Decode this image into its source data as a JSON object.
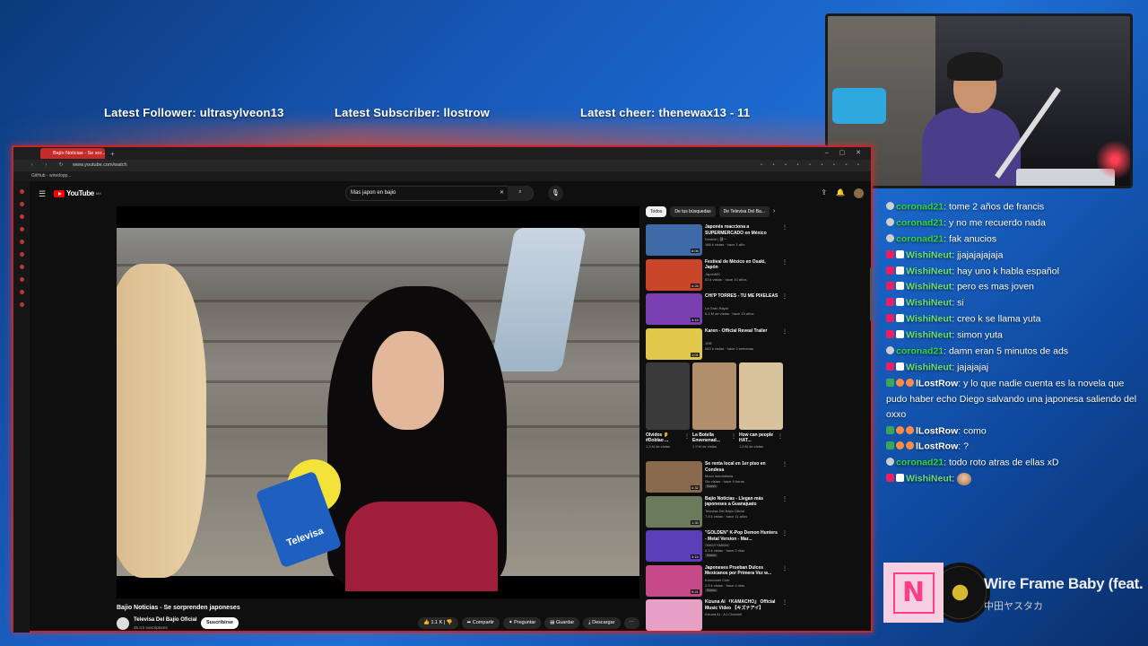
{
  "overlay": {
    "latest_follower": "Latest Follower: ultrasylveon13",
    "latest_subscriber": "Latest Subscriber: llostrow",
    "latest_cheer": "Latest cheer: thenewax13 - 11"
  },
  "chat": [
    {
      "user": "coronad21",
      "text": "tome 2 años de francis",
      "color": "#38d23b"
    },
    {
      "user": "coronad21",
      "text": "y no me recuerdo nada",
      "color": "#38d23b"
    },
    {
      "user": "coronad21",
      "text": "fak anucios",
      "color": "#38d23b"
    },
    {
      "user": "WishiNeut",
      "text": "jjajajajajaja",
      "color": "#6ee06e"
    },
    {
      "user": "WishiNeut",
      "text": "hay uno k habla español",
      "color": "#6ee06e"
    },
    {
      "user": "WishiNeut",
      "text": "pero es mas joven",
      "color": "#6ee06e"
    },
    {
      "user": "WishiNeut",
      "text": "si",
      "color": "#6ee06e"
    },
    {
      "user": "WishiNeut",
      "text": "creo k se llama yuta",
      "color": "#6ee06e"
    },
    {
      "user": "WishiNeut",
      "text": "simon yuta",
      "color": "#6ee06e"
    },
    {
      "user": "coronad21",
      "text": "damn eran 5 minutos de ads",
      "color": "#38d23b"
    },
    {
      "user": "WishiNeut",
      "text": "jajajajaj",
      "color": "#6ee06e"
    },
    {
      "user": "lLostRow",
      "text": "y lo que nadie cuenta es la novela que pudo haber echo Diego salvando una japonesa saliendo del oxxo",
      "color": "#ffffff"
    },
    {
      "user": "lLostRow",
      "text": "como",
      "color": "#ffffff"
    },
    {
      "user": "lLostRow",
      "text": "?",
      "color": "#ffffff"
    },
    {
      "user": "coronad21",
      "text": "todo roto atras de ellas xD",
      "color": "#38d23b"
    },
    {
      "user": "WishiNeut",
      "text": "",
      "color": "#6ee06e"
    }
  ],
  "now_playing": {
    "title": "Wire Frame Baby (feat.",
    "artist": "中田ヤスタカ",
    "logo": "N"
  },
  "browser": {
    "tab_title": "Bajío Noticias - Se sor...",
    "url": "www.youtube.com/watch",
    "bookmark": "GitHub - wiredopp..."
  },
  "youtube": {
    "logo_text": "YouTube",
    "logo_cc": "MX",
    "search_query": "Mas japon en bajio",
    "video_title": "Bajio Noticias - Se sorprenden japoneses",
    "channel": "Televisa Del Bajío Oficial",
    "subscribers": "45.3 k suscriptores",
    "subscribe": "Suscribirse",
    "likes": "1.1 K",
    "share": "Compartir",
    "ask": "Preguntar",
    "save": "Guardar",
    "download": "Descargar",
    "chips": [
      "Todos",
      "De tus búsquedas",
      "De Televisa Del Ba..."
    ],
    "recommendations": [
      {
        "title": "Japonés reacciona a SUPERMERCADO en México",
        "channel": "Kenichi | 健一",
        "views": "186 k vistas · hace 1 año",
        "duration": "8:06",
        "color": "#3f6aa8"
      },
      {
        "title": "Festival de México en Osaki, Japón",
        "channel": "JapónMX",
        "views": "53 k vistas · hace 10 años",
        "duration": "4:28",
        "color": "#c9462a"
      },
      {
        "title": "CHI'P TORRES - TÚ ME PIXELEAS",
        "channel": "La Gran Rayal",
        "views": "6.4 M de vistas · hace 13 años",
        "duration": "3:43",
        "color": "#7a3fb0"
      },
      {
        "title": "Karen - Official Reveal Trailer",
        "channel": "JDB",
        "views": "583 k vistas · hace 2 semanas",
        "duration": "1:01",
        "color": "#e0c84a"
      }
    ],
    "shorts": [
      {
        "title": "Olvidos 👂 #Doblao ...",
        "views": "1.3 M de vistas",
        "color": "#3a3a3a"
      },
      {
        "title": "La Botella Envenenad...",
        "views": "1.9 M de vistas",
        "color": "#b28f6c"
      },
      {
        "title": "How can people HAT...",
        "views": "1.8 M de vistas",
        "color": "#d9c39e"
      }
    ],
    "recommendations2": [
      {
        "title": "Se renta local en 1er piso en Condesa",
        "channel": "Moco inmobiliaria",
        "views": "Sin vistas · hace 9 horas",
        "badge": "Nuevo",
        "duration": "0:32",
        "color": "#8a6a4c"
      },
      {
        "title": "Bajío Noticias - Llegan más japoneses a Guanajuato",
        "channel": "Televisa Del Bajío Oficial",
        "views": "7.8 k vistas · hace 11 años",
        "badge": "",
        "duration": "1:30",
        "color": "#6b7a5a"
      },
      {
        "title": "\"GOLDEN\" K-Pop Demon Hunters - Metal Version - Mar...",
        "channel": "OMGITSMIMIC",
        "views": "5.3 k vistas · hace 2 días",
        "badge": "Nuevo",
        "duration": "3:15",
        "color": "#5a3fb8"
      },
      {
        "title": "Japoneses Prueban Dulces Mexicanos por Primera Vez w...",
        "channel": "Konnoruki Club",
        "views": "2.9 k vistas · hace 4 días",
        "badge": "Nuevo",
        "duration": "9:21",
        "color": "#c64a8a"
      },
      {
        "title": "Kizuna AI 『KAMACHO』 Official Music Video 【キズナアイ】",
        "channel": "Kizuna AI - A.I.Channel",
        "views": "",
        "badge": "",
        "duration": "",
        "color": "#e6a0c6"
      }
    ]
  }
}
